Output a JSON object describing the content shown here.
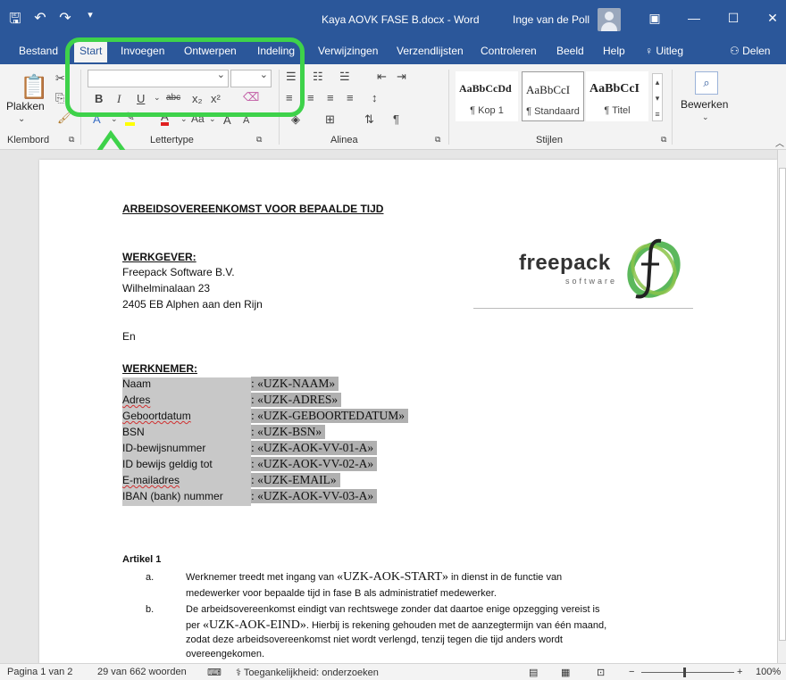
{
  "titlebar": {
    "doc_title": "Kaya AOVK FASE B.docx - Word",
    "user_name": "Inge van de Poll"
  },
  "tabs": [
    "Bestand",
    "Start",
    "Invoegen",
    "Ontwerpen",
    "Indeling",
    "Verwijzingen",
    "Verzendlijsten",
    "Controleren",
    "Beeld",
    "Help",
    "Uitleg",
    "Delen"
  ],
  "ribbon": {
    "paste_label": "Plakken",
    "groups": [
      "Klembord",
      "Lettertype",
      "Alinea",
      "Stijlen"
    ],
    "font_name": "",
    "font_size": "",
    "styles": [
      {
        "preview": "AaBbCcDd",
        "name": "¶ Kop 1"
      },
      {
        "preview": "AaBbCcI",
        "name": "¶ Standaard"
      },
      {
        "preview": "AaBbCcI",
        "name": "¶ Titel"
      }
    ],
    "edit_label": "Bewerken"
  },
  "document": {
    "heading": "ARBEIDSOVEREENKOMST VOOR  BEPAALDE TIJD",
    "employer_label": "WERKGEVER:",
    "employer_lines": [
      "Freepack Software B.V.",
      "Wilhelminalaan 23",
      "2405 EB Alphen aan den Rijn"
    ],
    "en": "En",
    "employee_label": "WERKNEMER:",
    "employee_fields": [
      {
        "label": "Naam",
        "value": ": «UZK-NAAM»"
      },
      {
        "label": "Adres",
        "value": ": «UZK-ADRES»"
      },
      {
        "label": "Geboortdatum",
        "value": ": «UZK-GEBOORTEDATUM»"
      },
      {
        "label": "BSN",
        "value": ": «UZK-BSN»"
      },
      {
        "label": "ID-bewijsnummer",
        "value": ": «UZK-AOK-VV-01-A»"
      },
      {
        "label": "ID bewijs geldig tot",
        "value": ": «UZK-AOK-VV-02-A»"
      },
      {
        "label": "E-mailadres",
        "value": ": «UZK-EMAIL»"
      },
      {
        "label": "IBAN (bank) nummer",
        "value": ": «UZK-AOK-VV-03-A»"
      }
    ],
    "artikel_title": "Artikel 1",
    "items": [
      {
        "marker": "a.",
        "lines": [
          {
            "pre": "Werknemer treedt met ingang van ",
            "field": "«UZK-AOK-START»",
            "post": " in dienst in de functie van"
          },
          {
            "pre": "medewerker voor bepaalde tijd in fase B als administratief medewerker.",
            "field": "",
            "post": ""
          }
        ]
      },
      {
        "marker": "b.",
        "lines": [
          {
            "pre": "De arbeidsovereenkomst eindigt van rechtswege zonder dat daartoe enige opzegging vereist is",
            "field": "",
            "post": ""
          },
          {
            "pre": "per ",
            "field": "«UZK-AOK-EIND»",
            "post": ". Hierbij is rekening gehouden met de aanzegtermijn van één maand,"
          },
          {
            "pre": "zodat deze arbeidsovereenkomst niet wordt verlengd, tenzij tegen die tijd anders wordt",
            "field": "",
            "post": ""
          },
          {
            "pre": "overeengekomen.",
            "field": "",
            "post": ""
          }
        ]
      }
    ],
    "logo_text": "freepack",
    "logo_sub": "software"
  },
  "statusbar": {
    "page": "Pagina 1 van 2",
    "words": "29 van 662 woorden",
    "accessibility": "Toegankelijkheid: onderzoeken",
    "zoom": "100%"
  },
  "colors": {
    "word_blue": "#2b579a",
    "highlight_green": "#3ed24a",
    "logo_green": "#4caf50"
  }
}
